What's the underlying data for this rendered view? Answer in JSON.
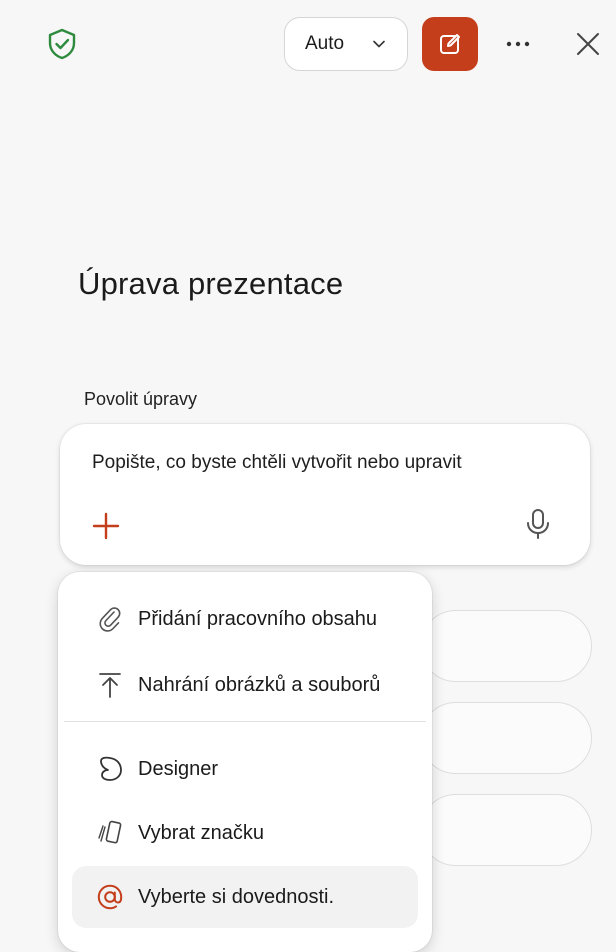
{
  "header": {
    "mode_select": {
      "value": "Auto"
    },
    "icons": {
      "shield": "shield-check-icon",
      "new_chat": "compose-icon",
      "more": "more-icon",
      "close": "close-icon"
    }
  },
  "main": {
    "title": "Úprava prezentace",
    "permission_label": "Povolit úpravy",
    "prompt": {
      "placeholder": "Popište, co byste chtěli vytvořit nebo upravit"
    }
  },
  "menu": {
    "items": [
      {
        "label": "Přidání pracovního obsahu",
        "icon": "paperclip-icon"
      },
      {
        "label": "Nahrání obrázků a souborů",
        "icon": "upload-icon"
      },
      {
        "label": "Designer",
        "icon": "designer-icon"
      },
      {
        "label": "Vybrat značku",
        "icon": "brand-icon"
      },
      {
        "label": "Vyberte si dovednosti.",
        "icon": "at-icon"
      }
    ]
  },
  "colors": {
    "accent": "#c43e1c",
    "shield": "#2e8b3e",
    "background": "#f7f7f7"
  }
}
